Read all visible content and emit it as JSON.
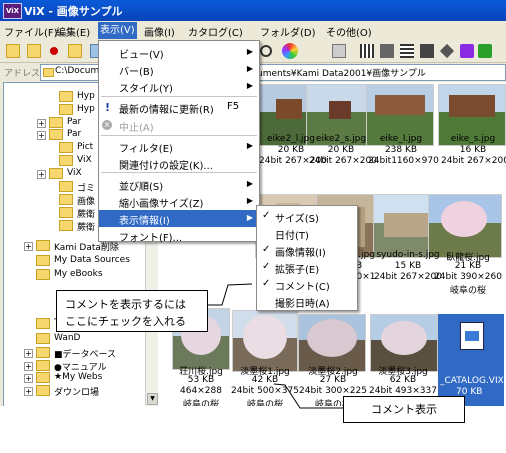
{
  "window": {
    "title": "ViX - 画像サンプル",
    "app_icon": "ViX"
  },
  "menubar": [
    "ファイル(F)",
    "編集(E)",
    "表示(V)",
    "画像(I)",
    "カタログ(C)",
    "フォルダ(D)",
    "その他(O)"
  ],
  "address": {
    "label": "アドレス",
    "path_left": "C:\\Documer",
    "path_right": "uments¥Kami Data2001¥画像サンプル"
  },
  "tree": [
    {
      "label": "Hyp",
      "expander": ""
    },
    {
      "label": "Hyp",
      "expander": ""
    },
    {
      "label": "Par",
      "expander": "+"
    },
    {
      "label": "Par",
      "expander": "+"
    },
    {
      "label": "Pict",
      "expander": ""
    },
    {
      "label": "ViX",
      "expander": ""
    },
    {
      "label": "ViX",
      "expander": "+"
    },
    {
      "label": "ゴミ",
      "expander": ""
    },
    {
      "label": "画像",
      "expander": ""
    },
    {
      "label": "蕨衛",
      "expander": ""
    },
    {
      "label": "蕨衛",
      "expander": ""
    },
    {
      "label": "Kami Data削除",
      "expander": "+"
    },
    {
      "label": "My Data Sources",
      "expander": ""
    },
    {
      "label": "My eBooks",
      "expander": ""
    },
    {
      "label": "ThinkBook",
      "expander": ""
    },
    {
      "label": "WanD",
      "expander": ""
    },
    {
      "label": "■データベース",
      "expander": "+"
    },
    {
      "label": "●マニュアル",
      "expander": "+"
    },
    {
      "label": "★My Webs",
      "expander": "+"
    },
    {
      "label": "ダウンロ場",
      "expander": "+"
    }
  ],
  "view_menu": {
    "items": [
      {
        "label": "ビュー(V)",
        "shortcut": "",
        "submenu": true
      },
      {
        "label": "バー(B)",
        "shortcut": "",
        "submenu": true
      },
      {
        "label": "スタイル(Y)",
        "shortcut": "",
        "submenu": true
      },
      {
        "label": "最新の情報に更新(R)",
        "shortcut": "F5",
        "submenu": false
      },
      {
        "label": "中止(A)",
        "shortcut": "",
        "submenu": false,
        "disabled": true
      },
      {
        "label": "フィルタ(E)",
        "shortcut": "",
        "submenu": true
      },
      {
        "label": "関連付けの設定(K)...",
        "shortcut": "",
        "submenu": false
      },
      {
        "label": "並び順(S)",
        "shortcut": "",
        "submenu": true
      },
      {
        "label": "縮小画像サイズ(Z)",
        "shortcut": "",
        "submenu": true
      },
      {
        "label": "表示情報(I)",
        "shortcut": "",
        "submenu": true,
        "selected": true
      },
      {
        "label": "フォント(F)...",
        "shortcut": "",
        "submenu": false
      }
    ]
  },
  "info_submenu": {
    "items": [
      {
        "label": "サイズ(S)",
        "checked": true
      },
      {
        "label": "日付(T)",
        "checked": false
      },
      {
        "label": "画像情報(I)",
        "checked": true
      },
      {
        "label": "拡張子(E)",
        "checked": true
      },
      {
        "label": "コメント(C)",
        "checked": true
      },
      {
        "label": "撮影日時(A)",
        "checked": false
      }
    ]
  },
  "thumbnails_row1": [
    {
      "name": "eike2_l.jpg",
      "size": "20 KB",
      "info": "24bit 267×200"
    },
    {
      "name": "eike2_s.jpg",
      "size": "20 KB",
      "info": "24bit 267×200"
    },
    {
      "name": "eike_l.jpg",
      "size": "238 KB",
      "info": "24bit1160×970"
    },
    {
      "name": "eike_s.jpg",
      "size": "16 KB",
      "info": "24bit 267×200"
    }
  ],
  "thumbnails_row2": [
    {
      "name": "syudoin1.jpg",
      "size": "759 KB",
      "info": "24bi 1000×753"
    },
    {
      "name": "syudoin.jpg",
      "size": "15 KB",
      "info": "24bi 200×1"
    },
    {
      "name": "syudo-in-s.jpg",
      "size": "15 KB",
      "info": "24bit 267×200"
    },
    {
      "name": "臥龍桜.jpg",
      "size": "21 KB",
      "info": "24bit 390×260",
      "comment": "岐阜の桜"
    }
  ],
  "thumbnails_row3": [
    {
      "name": "荘川桜.jpg",
      "size": "53 KB",
      "info": "464×288",
      "comment": "岐阜の桜"
    },
    {
      "name": "淡墨桜1.jpg",
      "size": "42 KB",
      "info": "24bit 500×375",
      "comment": "岐阜の桜"
    },
    {
      "name": "淡墨桜2.jpg",
      "size": "27 KB",
      "info": "24bit 300×225",
      "comment": "岐阜の桜"
    },
    {
      "name": "淡墨桜3.jpg",
      "size": "62 KB",
      "info": "24bit 493×337",
      "comment": "岐阜の桜"
    },
    {
      "name": "_CATALOG.VIX",
      "size": "70 KB",
      "info": "",
      "comment": ""
    }
  ],
  "tree_labels": {
    "pict": "Pict",
    "kami_data": "Kami Data削除"
  },
  "callouts": {
    "left_line1": "コメントを表示するには",
    "left_line2": "ここにチェックを入れる",
    "bottom": "コメント表示"
  },
  "colors": {
    "titlebar": "#0a5bd9",
    "selection": "#316ac5",
    "menu_bg": "#ece9d8"
  }
}
